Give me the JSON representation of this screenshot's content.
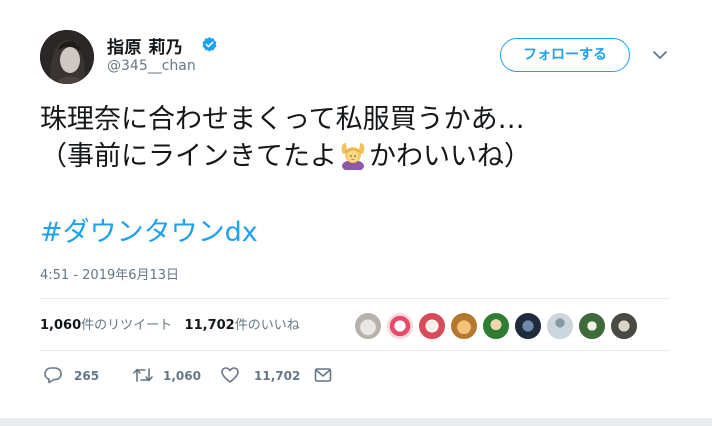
{
  "author": {
    "name": "指原 莉乃",
    "handle": "@345__chan"
  },
  "follow_button_label": "フォローする",
  "tweet": {
    "line1": "珠理奈に合わせまくって私服買うかあ…",
    "line2_before_emoji": "（事前にラインきてたよ",
    "line2_after_emoji": "かわいいね）",
    "emoji": "woman-gesturing-ok-emoji",
    "hashtag": "#ダウンタウンdx"
  },
  "timestamp": "4:51 - 2019年6月13日",
  "stats": {
    "retweets_count": "1,060",
    "retweets_label": "件のリツイート",
    "likes_count": "11,702",
    "likes_label": "件のいいね"
  },
  "actions": {
    "reply_count": "265",
    "retweet_count": "1,060",
    "like_count": "11,702"
  },
  "colors": {
    "accent": "#1da1f2",
    "muted": "#657786",
    "text": "#14171a",
    "divider": "#e6ecf0"
  }
}
